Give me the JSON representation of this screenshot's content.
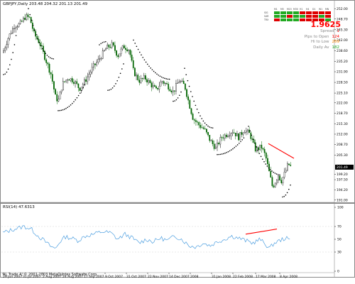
{
  "chart_header": {
    "symbol_label": "GBPJPY,Daily",
    "ohlc": "203.48 204.32 201.13 201.49"
  },
  "info_panel": {
    "signal_columns": [
      "M1",
      "M5",
      "M15",
      "M30",
      "H1",
      "H4",
      "D1",
      "W1",
      "MN"
    ],
    "signal_rows": [
      "SIG",
      "SAR",
      "TRX"
    ],
    "price": "1.9625",
    "rows": [
      {
        "label": "Spread",
        "value": "1",
        "color": "#ff0000"
      },
      {
        "label": "Pips to Open",
        "value": "124",
        "color": "#ff0000"
      },
      {
        "label": "Hi to Low",
        "value": "269",
        "color": "#ff8c00"
      },
      {
        "label": "Daily Av",
        "value": "182",
        "color": "#22aa22"
      }
    ]
  },
  "price_axis": [
    "252.00",
    "248.70",
    "245.30",
    "242.00",
    "238.60",
    "235.20",
    "231.90",
    "228.50",
    "225.10",
    "222.00",
    "218.70",
    "215.30",
    "212.00",
    "208.70",
    "205.30",
    "201.49",
    "199.20",
    "197.50",
    "194.20",
    "191.00"
  ],
  "rsi_label": "RSI(14) 47.6313",
  "rsi_axis": [
    "100",
    "70",
    "50",
    "30",
    "0"
  ],
  "date_axis": [
    "29 Jun 2007",
    "31 Jul 2007",
    "2 Aug 2007",
    "24 Aug 2007",
    "17 Sep 2007",
    "9 Oct 2007",
    "31 Oct 2007",
    "22 Nov 2007",
    "14 Dec 2007",
    "2008",
    "31 Jan 2008",
    "22 Feb 2008",
    "17 Mar 2008",
    "8 Apr 2008"
  ],
  "footer_text": "AL Trade 4, © 2001-2003 MetaQuotes Software Corp.",
  "colors": {
    "bull_candle": "#000000",
    "bear_candle": "#006400",
    "sar_dots": "#000000",
    "trendline": "#ff0000",
    "rsi_line": "#4d9fe0",
    "current_price_box": "#000000"
  }
}
